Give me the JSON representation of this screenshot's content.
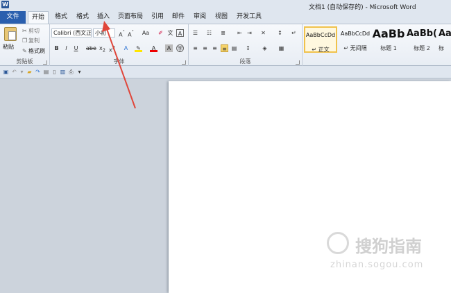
{
  "title": "文档1 (自动保存的)  -  Microsoft Word",
  "app_icon_letter": "W",
  "tabs": [
    {
      "label": "文件"
    },
    {
      "label": "开始"
    },
    {
      "label": "格式"
    },
    {
      "label": "格式"
    },
    {
      "label": "插入"
    },
    {
      "label": "页面布局"
    },
    {
      "label": "引用"
    },
    {
      "label": "邮件"
    },
    {
      "label": "审阅"
    },
    {
      "label": "视图"
    },
    {
      "label": "开发工具"
    }
  ],
  "clipboard": {
    "paste": "粘贴",
    "cut": "剪切",
    "copy": "复制",
    "format_painter": "格式刷",
    "group_label": "剪贴板"
  },
  "font": {
    "font_name": "Calibri (西文正",
    "font_size": "小初",
    "group_label": "字体"
  },
  "paragraph": {
    "group_label": "段落"
  },
  "styles": [
    {
      "sample": "AaBbCcDd",
      "name": "↵ 正文"
    },
    {
      "sample": "AaBbCcDd",
      "name": "↵ 无间隔"
    },
    {
      "sample": "AaBb",
      "name": "标题 1"
    },
    {
      "sample": "AaBb(",
      "name": "标题 2"
    },
    {
      "sample": "Aal",
      "name": "标"
    }
  ],
  "watermark": {
    "text": "搜狗指南",
    "url": "zhinan.sogou.com"
  },
  "colors": {
    "file_tab": "#2a5fae",
    "arrow": "#e0463a",
    "selected_style": "#f0c24b"
  }
}
